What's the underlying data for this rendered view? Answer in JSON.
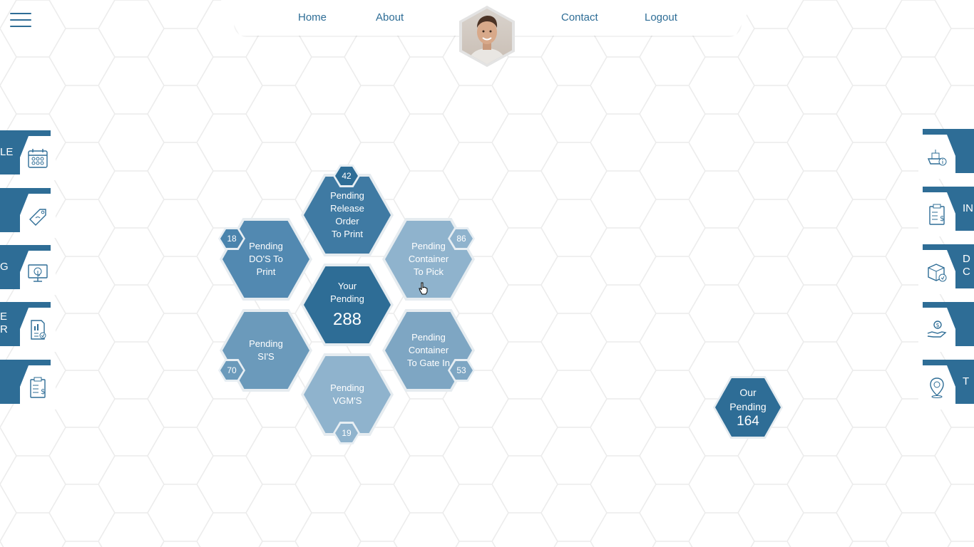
{
  "menu": {
    "icon": "hamburger-menu-icon"
  },
  "nav": {
    "home": "Home",
    "about": "About",
    "contact": "Contact",
    "logout": "Logout"
  },
  "colors": {
    "primary": "#2e6d96",
    "mid": "#4a84ad",
    "light": "#6b9abb",
    "lighter": "#8fb3cd"
  },
  "hexes": {
    "release": {
      "lines": [
        "Pending",
        "Release",
        "Order",
        "To Print"
      ],
      "count": "42"
    },
    "dos": {
      "lines": [
        "Pending",
        "DO'S To",
        "Print"
      ],
      "count": "18"
    },
    "pick": {
      "lines": [
        "Pending",
        "Container",
        "To Pick"
      ],
      "count": "86"
    },
    "center": {
      "lines": [
        "Your",
        "Pending"
      ],
      "count": "288"
    },
    "sis": {
      "lines": [
        "Pending",
        "SI'S"
      ],
      "count": "70"
    },
    "gatein": {
      "lines": [
        "Pending",
        "Container",
        "To Gate In"
      ],
      "count": "53"
    },
    "vgm": {
      "lines": [
        "Pending",
        "VGM'S"
      ],
      "count": "19"
    }
  },
  "our_pending": {
    "line1": "Our",
    "line2": "Pending",
    "count": "164"
  },
  "left_tabs": [
    {
      "label": "LE",
      "icon": "calendar-icon"
    },
    {
      "label": "",
      "icon": "tag-icon"
    },
    {
      "label": "G",
      "icon": "monitor-touch-icon"
    },
    {
      "label": "E\nR",
      "icon": "report-check-icon"
    },
    {
      "label": "",
      "icon": "clipboard-dollar-icon"
    }
  ],
  "right_tabs": [
    {
      "label": "",
      "icon": "ship-info-icon"
    },
    {
      "label": "IN",
      "icon": "clipboard-dollar-icon"
    },
    {
      "label": "D\nC",
      "icon": "box-check-icon"
    },
    {
      "label": "",
      "icon": "hand-coin-icon"
    },
    {
      "label": "T",
      "icon": "location-pin-icon"
    }
  ]
}
